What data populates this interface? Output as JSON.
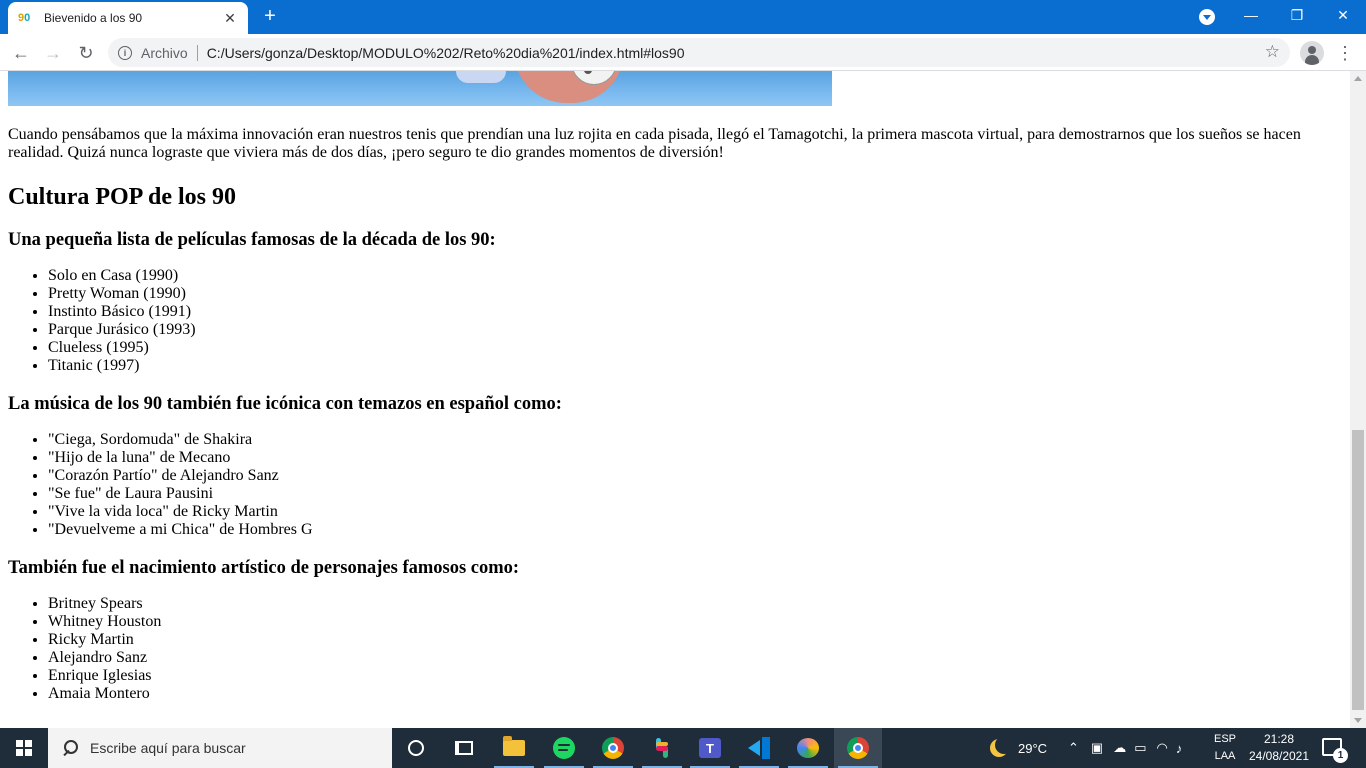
{
  "browser": {
    "tab": {
      "favicon_text_1": "9",
      "favicon_text_2": "0",
      "title": "Bievenido a los 90"
    },
    "address": {
      "scheme_label": "Archivo",
      "url": "C:/Users/gonza/Desktop/MODULO%202/Reto%20dia%201/index.html#los90"
    }
  },
  "page": {
    "intro_paragraph": "Cuando pensábamos que la máxima innovación eran nuestros tenis que prendían una luz rojita en cada pisada, llegó el Tamagotchi, la primera mascota virtual, para demostrarnos que los sueños se hacen realidad. Quizá nunca lograste que viviera más de dos días, ¡pero seguro te dio grandes momentos de diversión!",
    "section_title": "Cultura POP de los 90",
    "movies": {
      "heading": "Una pequeña lista de películas famosas de la década de los 90:",
      "items": [
        "Solo en Casa (1990)",
        "Pretty Woman (1990)",
        "Instinto Básico (1991)",
        "Parque Jurásico (1993)",
        "Clueless (1995)",
        "Titanic (1997)"
      ]
    },
    "music": {
      "heading": "La música de los 90 también fue icónica con temazos en español como:",
      "items": [
        "\"Ciega, Sordomuda\" de Shakira",
        "\"Hijo de la luna\" de Mecano",
        "\"Corazón Partío\" de Alejandro Sanz",
        "\"Se fue\" de Laura Pausini",
        "\"Vive la vida loca\" de Ricky Martin",
        "\"Devuelveme a mi Chica\" de Hombres G"
      ]
    },
    "artists": {
      "heading": "También fue el nacimiento artístico de personajes famosos como:",
      "items": [
        "Britney Spears",
        "Whitney Houston",
        "Ricky Martin",
        "Alejandro Sanz",
        "Enrique Iglesias",
        "Amaia Montero"
      ]
    }
  },
  "taskbar": {
    "search_placeholder": "Escribe aquí para buscar",
    "teams_letter": "T",
    "weather": "29°C",
    "lang_line1": "ESP",
    "lang_line2": "LAA",
    "time": "21:28",
    "date": "24/08/2021",
    "notification_count": "1"
  },
  "colors": {
    "titlebar": "#0a6ed1",
    "taskbar": "#1f2d3a"
  }
}
